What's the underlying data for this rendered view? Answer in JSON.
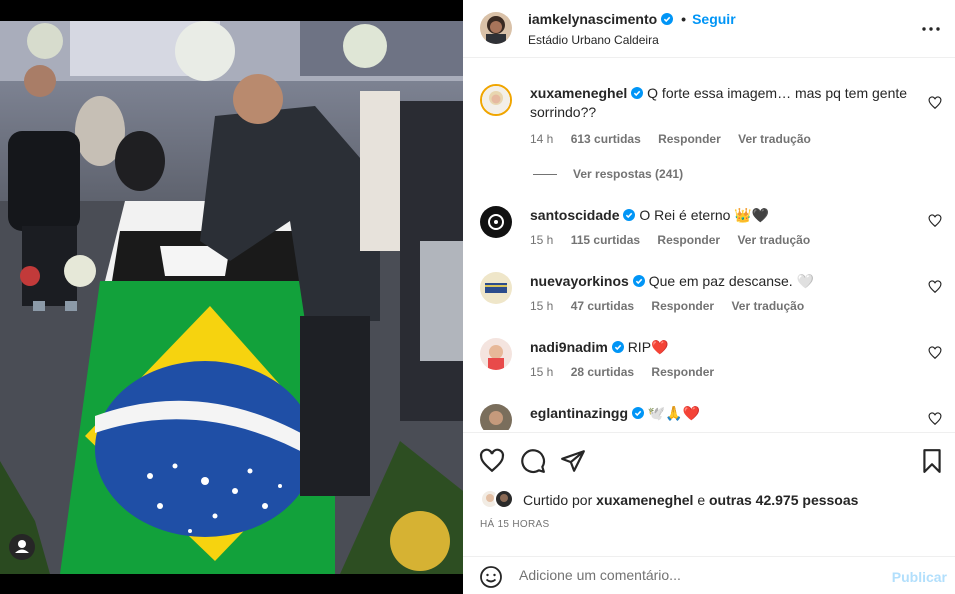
{
  "post": {
    "author": "iamkelynascimento",
    "location": "Estádio Urbano Caldeira",
    "follow_label": "Seguir",
    "dot": "•"
  },
  "comments": [
    {
      "user": "xuxameneghel",
      "text": "Q forte essa imagem… mas pq tem gente sorrindo??",
      "time": "14 h",
      "likes": "613 curtidas",
      "reply": "Responder",
      "translate": "Ver tradução",
      "view_replies": "Ver respostas (241)"
    },
    {
      "user": "santoscidade",
      "text": "O Rei é eterno 👑🖤",
      "time": "15 h",
      "likes": "115 curtidas",
      "reply": "Responder",
      "translate": "Ver tradução"
    },
    {
      "user": "nuevayorkinos",
      "text": "Que em paz descanse. 🤍",
      "time": "15 h",
      "likes": "47 curtidas",
      "reply": "Responder",
      "translate": "Ver tradução"
    },
    {
      "user": "nadi9nadim",
      "text": "RIP❤️",
      "time": "15 h",
      "likes": "28 curtidas",
      "reply": "Responder"
    },
    {
      "user": "eglantinazingg",
      "text": "🕊️🙏❤️"
    }
  ],
  "likes_line": {
    "prefix": "Curtido por",
    "user": "xuxameneghel",
    "middle": "e",
    "count": "outras 42.975 pessoas"
  },
  "time_ago": "HÁ 15 HORAS",
  "comment_input": {
    "placeholder": "Adicione um comentário..."
  },
  "publish_label": "Publicar",
  "colors": {
    "accent": "#0095f6",
    "publish_disabled": "#b2dffc",
    "muted": "#737373"
  }
}
